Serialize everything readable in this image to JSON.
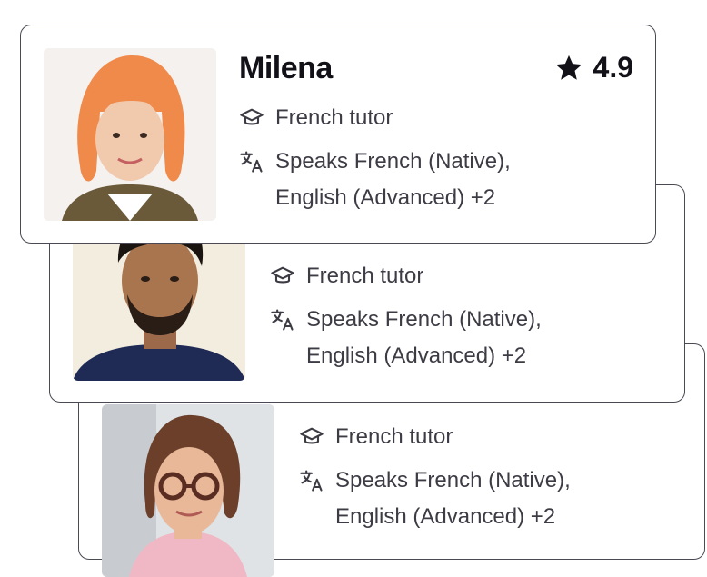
{
  "cards": [
    {
      "name": "Milena",
      "rating": "4.9",
      "subject": "French tutor",
      "languages_line1": "Speaks French (Native),",
      "languages_line2": "English (Advanced) +2"
    },
    {
      "name": "",
      "subject": "French tutor",
      "languages_line1": "Speaks French (Native),",
      "languages_line2": "English (Advanced) +2"
    },
    {
      "name": "",
      "subject": "French tutor",
      "languages_line1": "Speaks French (Native),",
      "languages_line2": "English (Advanced) +2"
    }
  ],
  "icons": {
    "subject": "graduation-cap-icon",
    "languages": "translate-icon",
    "rating": "star-icon"
  },
  "colors": {
    "card_border": "#4a4a55",
    "text_primary": "#121117",
    "text_secondary": "#3d3c45"
  }
}
